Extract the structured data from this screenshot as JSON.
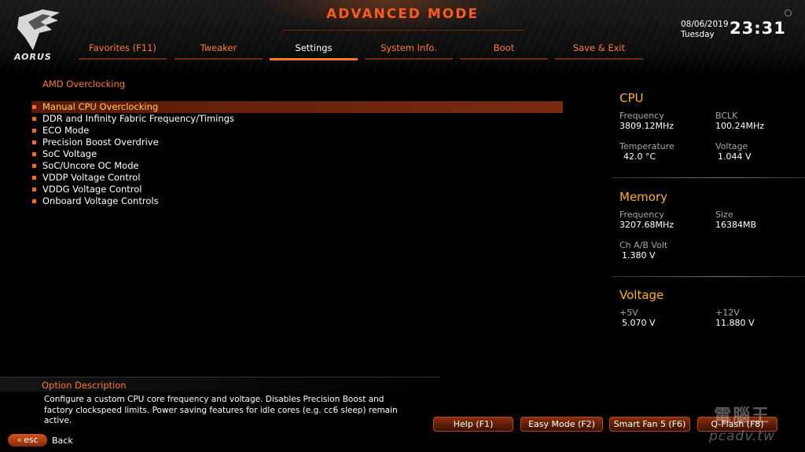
{
  "header": {
    "mode_title": "ADVANCED MODE",
    "logo_text": "AORUS",
    "date": "08/06/2019",
    "weekday": "Tuesday",
    "time": "23:31",
    "tabs": [
      {
        "label": "Favorites (F11)"
      },
      {
        "label": "Tweaker"
      },
      {
        "label": "Settings"
      },
      {
        "label": "System Info."
      },
      {
        "label": "Boot"
      },
      {
        "label": "Save & Exit"
      }
    ],
    "active_tab": "Settings"
  },
  "main": {
    "section_title": "AMD Overclocking",
    "items": [
      {
        "label": "Manual CPU Overclocking"
      },
      {
        "label": "DDR and Infinity Fabric Frequency/Timings"
      },
      {
        "label": "ECO Mode"
      },
      {
        "label": "Precision Boost Overdrive"
      },
      {
        "label": "SoC Voltage"
      },
      {
        "label": "SoC/Uncore OC Mode"
      },
      {
        "label": "VDDP Voltage Control"
      },
      {
        "label": "VDDG Voltage Control"
      },
      {
        "label": "Onboard Voltage Controls"
      }
    ],
    "selected_item": "Manual CPU Overclocking"
  },
  "panel": {
    "cpu": {
      "title": "CPU",
      "frequency_label": "Frequency",
      "frequency": "3809.12MHz",
      "bclk_label": "BCLK",
      "bclk": "100.24MHz",
      "temperature_label": "Temperature",
      "temperature": "42.0 °C",
      "voltage_label": "Voltage",
      "voltage": "1.044 V"
    },
    "memory": {
      "title": "Memory",
      "frequency_label": "Frequency",
      "frequency": "3207.68MHz",
      "size_label": "Size",
      "size": "16384MB",
      "volt_label": "Ch A/B Volt",
      "volt": "1.380 V"
    },
    "voltage": {
      "title": "Voltage",
      "v5_label": "+5V",
      "v5": "5.070 V",
      "v12_label": "+12V",
      "v12": "11.880 V"
    }
  },
  "footer": {
    "description_title": "Option Description",
    "description": "Configure a custom CPU core frequency and voltage. Disables Precision Boost and factory clockspeed limits. Power saving features for idle cores (e.g. cc6 sleep) remain active.",
    "esc_label": "esc",
    "back_label": "Back",
    "buttons": [
      {
        "label": "Help (F1)"
      },
      {
        "label": "Easy Mode (F2)"
      },
      {
        "label": "Smart Fan 5 (F6)"
      },
      {
        "label": "Q-Flash (F8)"
      }
    ]
  },
  "watermark": {
    "title": "電腦王",
    "url": "pcadv.tw"
  },
  "colors": {
    "accent": "#ff7a1e",
    "panel_heading": "#ffb21a",
    "selected_text": "#ffd24a"
  }
}
